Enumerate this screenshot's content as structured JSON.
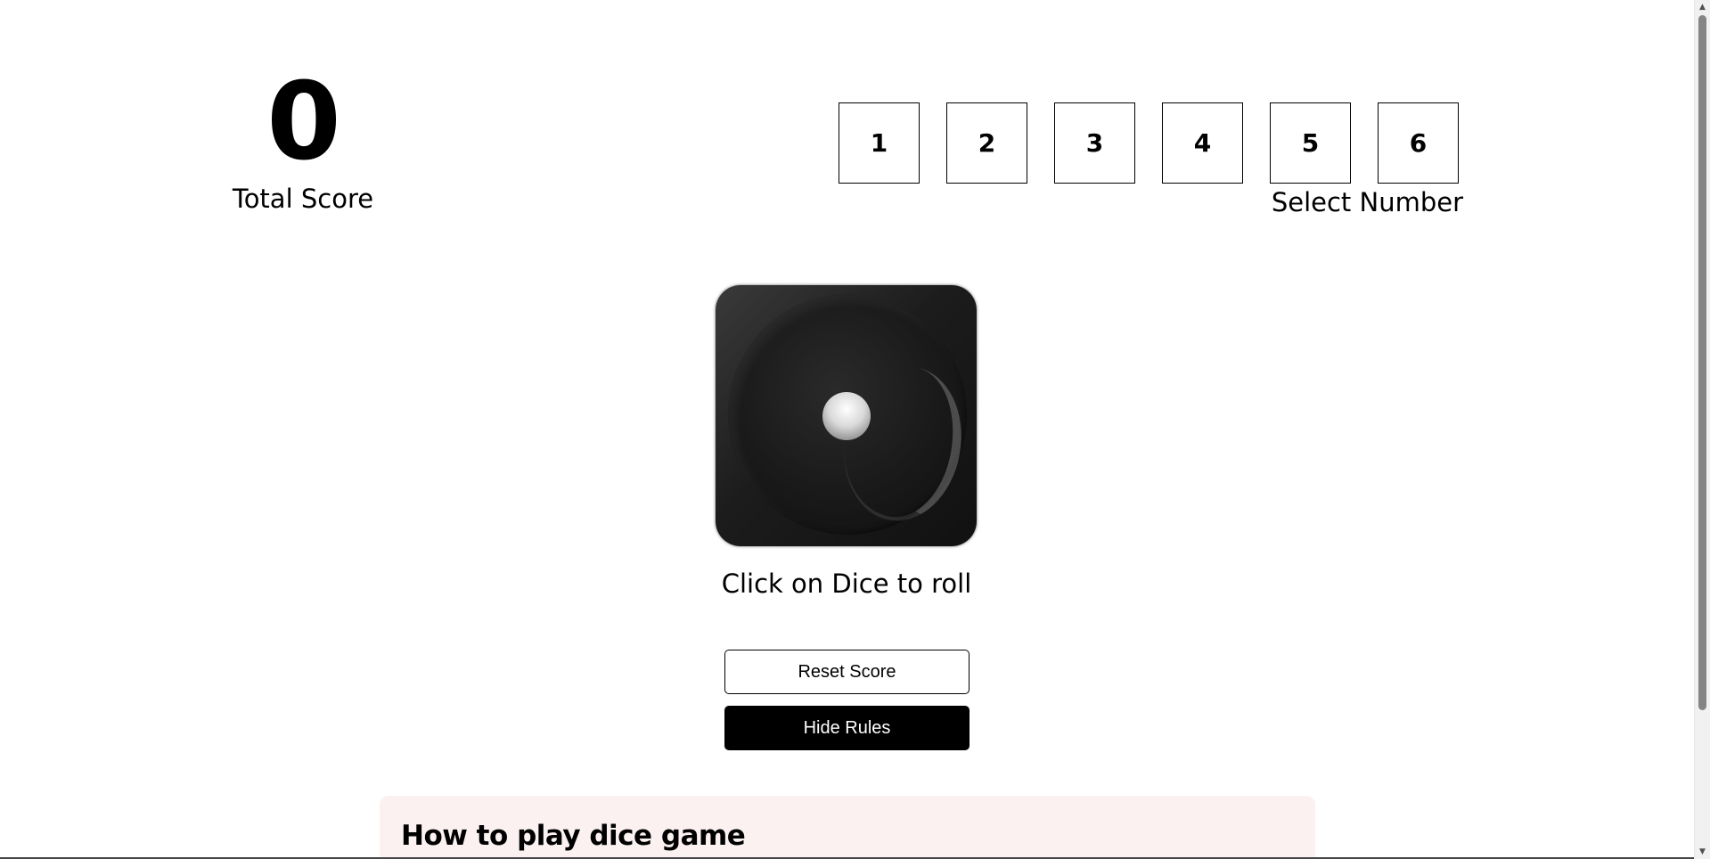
{
  "score": {
    "value": "0",
    "label": "Total Score"
  },
  "number_selector": {
    "numbers": [
      "1",
      "2",
      "3",
      "4",
      "5",
      "6"
    ],
    "label": "Select Number"
  },
  "dice": {
    "face_value": 1,
    "caption": "Click on Dice to roll"
  },
  "buttons": {
    "reset_label": "Reset Score",
    "rules_label": "Hide Rules"
  },
  "rules": {
    "title": "How to play dice game"
  },
  "colors": {
    "rules_background": "#fbf1f1",
    "primary_button_bg": "#000000",
    "primary_button_text": "#ffffff"
  }
}
